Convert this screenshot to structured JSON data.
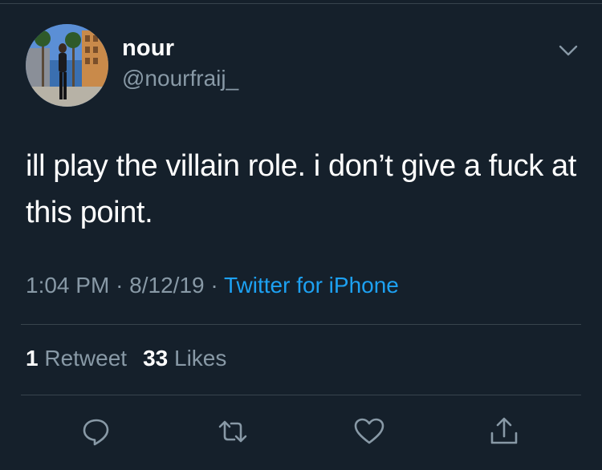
{
  "user": {
    "display_name": "nour",
    "handle": "@nourfraij_"
  },
  "tweet": {
    "text": "ill play the villain role. i don’t give a fuck at this point.",
    "time": "1:04 PM",
    "date": "8/12/19",
    "separator": "·",
    "source": "Twitter for iPhone"
  },
  "stats": {
    "retweets_count": "1",
    "retweets_label": "Retweet",
    "likes_count": "33",
    "likes_label": "Likes"
  },
  "actions": [
    "reply-icon",
    "retweet-icon",
    "like-icon",
    "share-icon"
  ],
  "colors": {
    "background": "#15202b",
    "primary_text": "#ffffff",
    "secondary_text": "#8899a6",
    "link": "#1da1f2",
    "divider": "#38444d"
  }
}
